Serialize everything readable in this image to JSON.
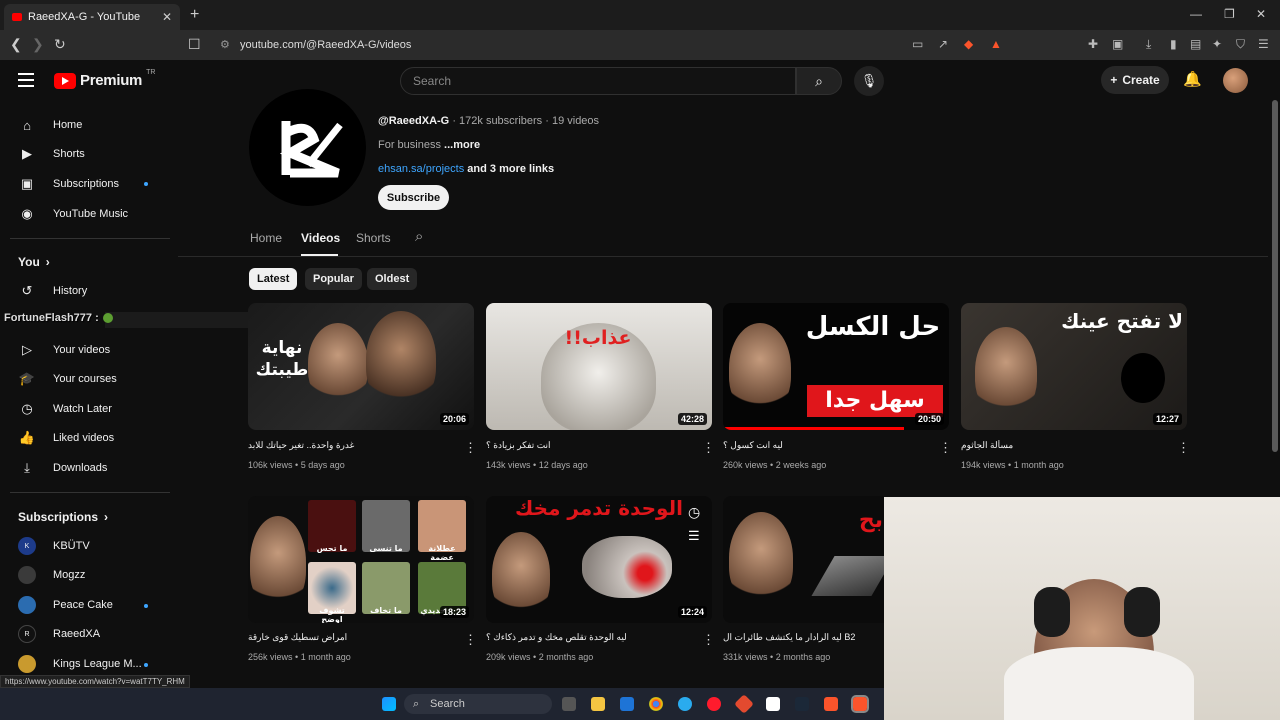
{
  "browser": {
    "tab_title": "RaeedXA-G - YouTube",
    "url": "youtube.com/@RaeedXA-G/videos",
    "status_url": "https://www.youtube.com/watch?v=watT7TY_RHM"
  },
  "header": {
    "logo_text": "Premium",
    "country_code": "TR",
    "search_placeholder": "Search",
    "create_label": "Create"
  },
  "sidebar": {
    "main": [
      {
        "label": "Home",
        "icon": "home-icon"
      },
      {
        "label": "Shorts",
        "icon": "shorts-icon"
      },
      {
        "label": "Subscriptions",
        "icon": "subscriptions-icon"
      },
      {
        "label": "YouTube Music",
        "icon": "music-icon"
      }
    ],
    "you_label": "You",
    "you_items": [
      {
        "label": "History",
        "icon": "history-icon"
      },
      {
        "label": "Your videos",
        "icon": "your-videos-icon"
      },
      {
        "label": "Your courses",
        "icon": "courses-icon"
      },
      {
        "label": "Watch Later",
        "icon": "watch-later-icon"
      },
      {
        "label": "Liked videos",
        "icon": "like-icon"
      },
      {
        "label": "Downloads",
        "icon": "download-icon"
      }
    ],
    "subscriptions_label": "Subscriptions",
    "subscriptions": [
      {
        "label": "KBÜTV"
      },
      {
        "label": "Mogzz"
      },
      {
        "label": "Peace Cake"
      },
      {
        "label": "RaeedXA"
      },
      {
        "label": "Kings League M..."
      }
    ]
  },
  "overlay_username": "FortuneFlash777 :",
  "channel": {
    "name_partial": "RaeedXA-G",
    "handle": "@RaeedXA-G",
    "stats": "· 172k subscribers · 19 videos",
    "desc": "For business",
    "more": "...more",
    "link": "ehsan.sa/projects",
    "more_links": "and 3 more links",
    "subscribe": "Subscribe",
    "tabs": [
      "Home",
      "Videos",
      "Shorts"
    ],
    "chips": [
      "Latest",
      "Popular",
      "Oldest"
    ]
  },
  "videos": [
    {
      "thumb_text": "نهاية طيبتك",
      "title": "غدرة واحدة.. تغير حياتك للابد",
      "views": "106k views",
      "age": "5 days ago",
      "duration": "20:06"
    },
    {
      "thumb_text": "عذاب!!",
      "title": "انت تفكر بزيادة ؟",
      "views": "143k views",
      "age": "12 days ago",
      "duration": "42:28"
    },
    {
      "thumb_text": "حل الكسل",
      "thumb_text2": "سهل جدا",
      "title": "ليه انت كسول ؟",
      "views": "260k views",
      "age": "2 weeks ago",
      "duration": "20:50"
    },
    {
      "thumb_text": "لا تفتح عينك",
      "title": "مسألة الجاثوم",
      "views": "194k views",
      "age": "1 month ago",
      "duration": "12:27"
    },
    {
      "thumb_text": "",
      "title": "امراض تسطيك قوى خارقة",
      "views": "256k views",
      "age": "1 month ago",
      "duration": "18:23"
    },
    {
      "thumb_text": "الوحدة تدمر مخك",
      "title": "ليه الوحدة تقلص مخك و تدمر ذكاءك ؟",
      "views": "209k views",
      "age": "2 months ago",
      "duration": "12:24"
    },
    {
      "thumb_text": "بح",
      "title": "ليه الرادار ما يكتشف طائرات ال B2",
      "views": "331k views",
      "age": "2 months ago",
      "duration": ""
    }
  ],
  "grid_labels": [
    "ما تحس",
    "ما تنسى",
    "عطلانة عضمة",
    "تشوف اوضح",
    "ما تخاف",
    "حديدي"
  ],
  "taskbar": {
    "search": "Search"
  },
  "colors": {
    "accent_red": "#ff0000",
    "link_blue": "#3ea6ff",
    "bg": "#0f0f0f"
  }
}
